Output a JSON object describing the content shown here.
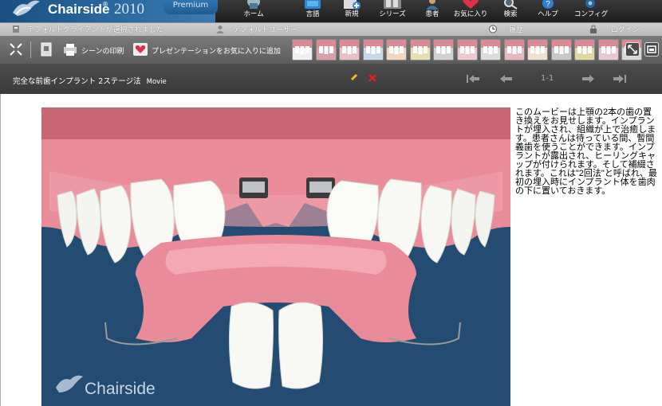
{
  "brand": {
    "name": "Chairside",
    "trademark": "®",
    "year": "2010",
    "edition": "Premium"
  },
  "nav": [
    {
      "label": "ホーム",
      "icon": "home-icon"
    },
    {
      "label": "言語",
      "icon": "language-icon"
    },
    {
      "label": "新規",
      "icon": "new-icon"
    },
    {
      "label": "シリーズ",
      "icon": "series-icon"
    },
    {
      "label": "患者",
      "icon": "patient-icon"
    },
    {
      "label": "お気に入り",
      "icon": "favorites-icon"
    },
    {
      "label": "検索",
      "icon": "search-icon"
    },
    {
      "label": "ヘルプ",
      "icon": "help-icon"
    },
    {
      "label": "コンフィグ",
      "icon": "config-icon"
    }
  ],
  "status": {
    "client": "デフォルトクライアントが選択されました",
    "user": "デフォルトユーザー",
    "history": "履歴",
    "login": "ログイン"
  },
  "toolbar": {
    "print_label": "シーンの印刷",
    "favorite_label": "プレゼンテーションをお気に入りに追加",
    "thumbnail_count": 15
  },
  "movie": {
    "title": "完全な前歯インプラント 2ステージ法",
    "type": "Movie",
    "page": "1-1"
  },
  "description": "このムービーは上顎の2本の歯の置き換えをお見せします。インプラントが埋入され、組織が上で治癒します。患者さんは待っている間、暫間義歯を使うことができます。インプラントが露出され、ヒーリングキャップが付けられます。そして補綴されます。これは\"2回法\"と呼ばれ、最初の埋入時にインプラント体を歯肉の下に置いておきます。",
  "watermark": "Chairside",
  "colors": {
    "brand_blue": "#2b6aa0",
    "viewer_bg": "#244c72",
    "gum_pink": "#e98b98",
    "edit_yellow": "#f0c020",
    "delete_red": "#e02020"
  }
}
